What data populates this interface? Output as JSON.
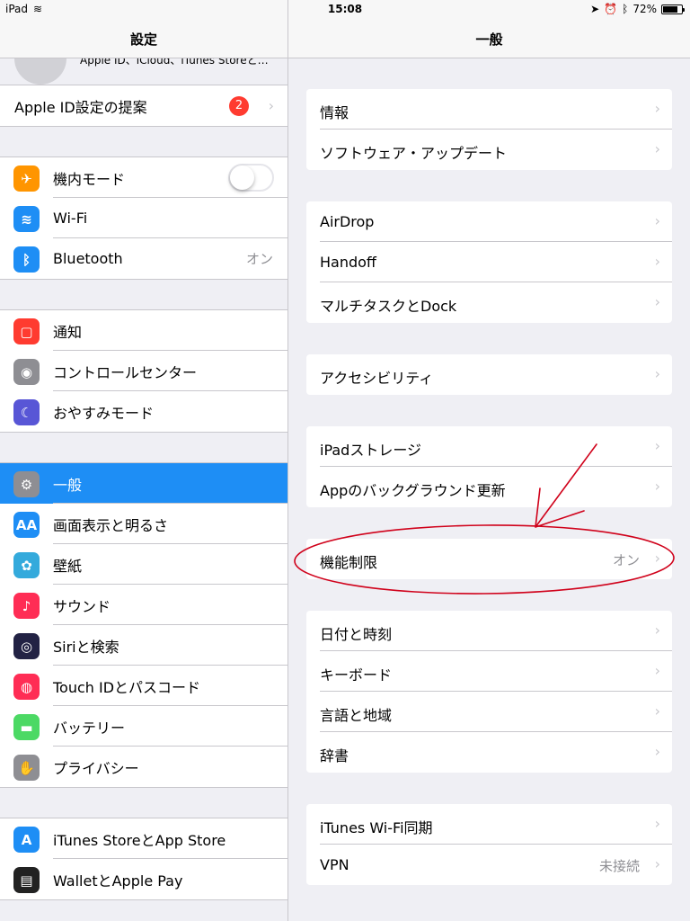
{
  "status": {
    "device": "iPad",
    "time": "15:08",
    "battery": "72%",
    "battery_level": 0.72
  },
  "sidebar": {
    "title": "設定",
    "profile_subtitle": "Apple ID、iCloud、iTunes Storeと…",
    "suggestion": {
      "label": "Apple ID設定の提案",
      "badge": "2"
    },
    "groups": [
      [
        {
          "label": "機内モード",
          "icon": "airplane-icon",
          "color": "#ff9500",
          "glyph": "✈",
          "toggle": true
        },
        {
          "label": "Wi-Fi",
          "icon": "wifi-icon",
          "color": "#1e8ef5",
          "glyph": "≋"
        },
        {
          "label": "Bluetooth",
          "icon": "bluetooth-icon",
          "color": "#1e8ef5",
          "glyph": "ᛒ",
          "value": "オン"
        }
      ],
      [
        {
          "label": "通知",
          "icon": "notifications-icon",
          "color": "#ff3b30",
          "glyph": "▢"
        },
        {
          "label": "コントロールセンター",
          "icon": "control-center-icon",
          "color": "#8e8e93",
          "glyph": "◉"
        },
        {
          "label": "おやすみモード",
          "icon": "moon-icon",
          "color": "#5856d6",
          "glyph": "☾"
        }
      ],
      [
        {
          "label": "一般",
          "icon": "gear-icon",
          "color": "#8e8e93",
          "glyph": "⚙",
          "selected": true
        },
        {
          "label": "画面表示と明るさ",
          "icon": "display-icon",
          "color": "#1e8ef5",
          "glyph": "AA"
        },
        {
          "label": "壁紙",
          "icon": "wallpaper-icon",
          "color": "#34aadc",
          "glyph": "✿"
        },
        {
          "label": "サウンド",
          "icon": "sound-icon",
          "color": "#ff2d55",
          "glyph": "♪"
        },
        {
          "label": "Siriと検索",
          "icon": "siri-icon",
          "color": "#222244",
          "glyph": "◎"
        },
        {
          "label": "Touch IDとパスコード",
          "icon": "fingerprint-icon",
          "color": "#ff2d55",
          "glyph": "◍"
        },
        {
          "label": "バッテリー",
          "icon": "battery-icon",
          "color": "#4cd964",
          "glyph": "▬"
        },
        {
          "label": "プライバシー",
          "icon": "privacy-hand-icon",
          "color": "#8e8e93",
          "glyph": "✋"
        }
      ],
      [
        {
          "label": "iTunes StoreとApp Store",
          "icon": "app-store-icon",
          "color": "#1e8ef5",
          "glyph": "A"
        },
        {
          "label": "WalletとApple Pay",
          "icon": "wallet-icon",
          "color": "#222222",
          "glyph": "▤"
        }
      ]
    ]
  },
  "main": {
    "title": "一般",
    "groups": [
      [
        {
          "label": "情報"
        },
        {
          "label": "ソフトウェア・アップデート"
        }
      ],
      [
        {
          "label": "AirDrop"
        },
        {
          "label": "Handoff"
        },
        {
          "label": "マルチタスクとDock"
        }
      ],
      [
        {
          "label": "アクセシビリティ"
        }
      ],
      [
        {
          "label": "iPadストレージ"
        },
        {
          "label": "Appのバックグラウンド更新"
        }
      ],
      [
        {
          "label": "機能制限",
          "value": "オン"
        }
      ],
      [
        {
          "label": "日付と時刻"
        },
        {
          "label": "キーボード"
        },
        {
          "label": "言語と地域"
        },
        {
          "label": "辞書"
        }
      ],
      [
        {
          "label": "iTunes Wi-Fi同期"
        },
        {
          "label": "VPN",
          "value": "未接続"
        }
      ]
    ]
  },
  "annotation_color": "#d0021b"
}
